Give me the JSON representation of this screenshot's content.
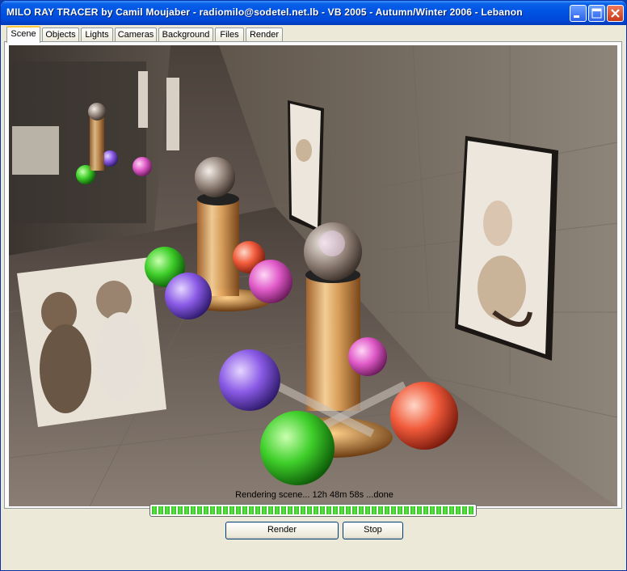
{
  "window": {
    "title": "MILO RAY TRACER by Camil Moujaber - radiomilo@sodetel.net.lb - VB 2005 - Autumn/Winter 2006 - Lebanon",
    "controls": [
      "minimize-icon",
      "maximize-icon",
      "close-icon"
    ]
  },
  "tabs": [
    {
      "label": "Scene",
      "active": true
    },
    {
      "label": "Objects",
      "active": false
    },
    {
      "label": "Lights",
      "active": false
    },
    {
      "label": "Cameras",
      "active": false
    },
    {
      "label": "Background",
      "active": false
    },
    {
      "label": "Files",
      "active": false
    },
    {
      "label": "Render",
      "active": false
    }
  ],
  "render": {
    "description_visible": "ray-traced image: glass spheres on pillars, cat photos on tiled walls"
  },
  "status": {
    "text": "Rendering scene... 12h 48m 58s ...done",
    "progress_percent": 100
  },
  "buttons": {
    "render_label": "Render",
    "stop_label": "Stop"
  },
  "colors": {
    "titlebar": "#0055e5",
    "face": "#ece9d8",
    "progress": "#2fbf1f",
    "tab_highlight": "#ffc83c"
  }
}
